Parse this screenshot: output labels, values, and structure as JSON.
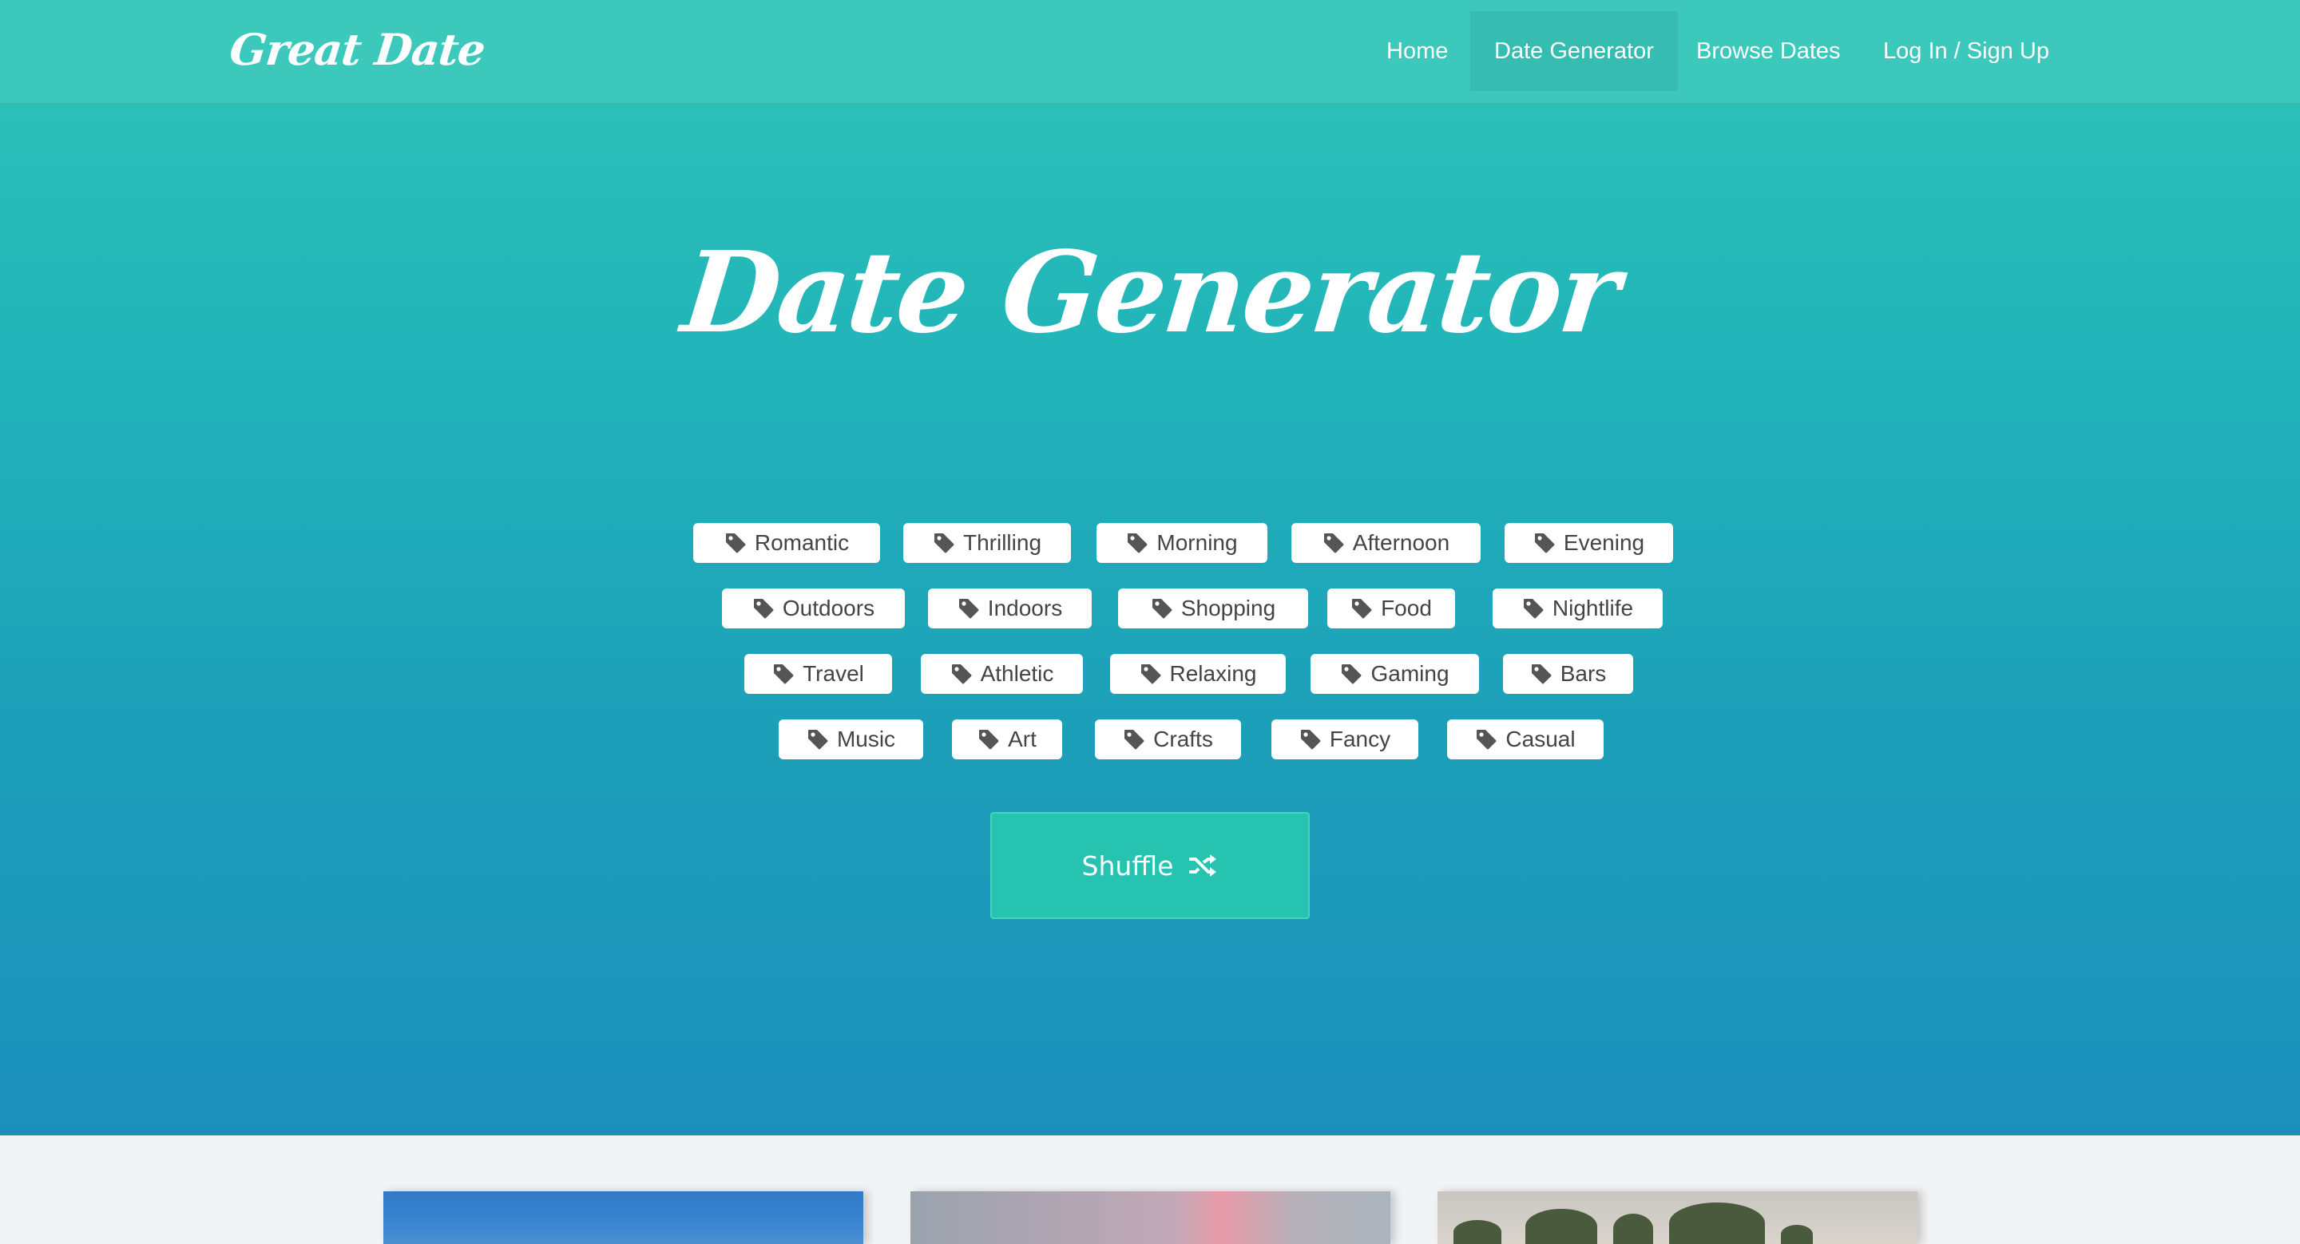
{
  "navbar": {
    "brand": "Great Date",
    "items": [
      {
        "label": "Home",
        "active": false
      },
      {
        "label": "Date Generator",
        "active": true
      },
      {
        "label": "Browse Dates",
        "active": false
      },
      {
        "label": "Log In / Sign Up",
        "active": false
      }
    ]
  },
  "hero": {
    "title": "Date Generator",
    "tags": [
      [
        "Romantic",
        "Thrilling",
        "Morning",
        "Afternoon",
        "Evening"
      ],
      [
        "Outdoors",
        "Indoors",
        "Shopping",
        "Food",
        "Nightlife"
      ],
      [
        "Travel",
        "Athletic",
        "Relaxing",
        "Gaming",
        "Bars"
      ],
      [
        "Music",
        "Art",
        "Crafts",
        "Fancy",
        "Casual"
      ]
    ],
    "tag_icon": "tag-icon",
    "shuffle_label": "Shuffle",
    "shuffle_icon": "shuffle-icon"
  },
  "colors": {
    "navbar": "#3cc9bc",
    "hero_top": "#2ec4b6",
    "hero_bottom": "#1b8fbb",
    "shuffle_button": "#26c3b0",
    "tag_background": "#ffffff",
    "tag_text": "#444444"
  }
}
